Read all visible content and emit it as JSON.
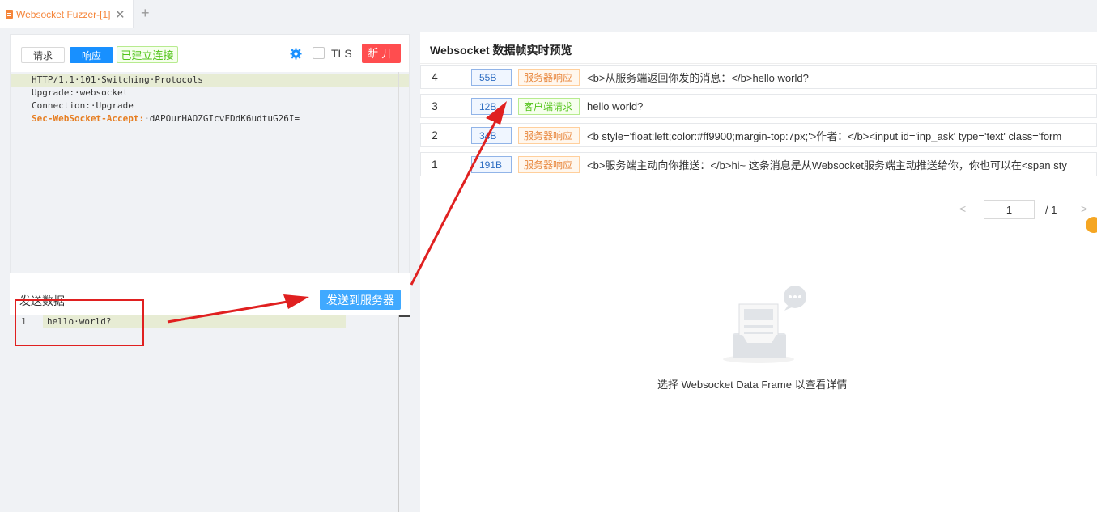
{
  "tab": {
    "title": "Websocket Fuzzer-[1]",
    "close": "✕",
    "add": "+"
  },
  "toolbar": {
    "request_label": "请求",
    "response_label": "响应",
    "status_label": "已建立连接",
    "tls_label": "TLS",
    "disconnect_label": "断开"
  },
  "response_editor": {
    "lines": [
      {
        "text": "HTTP/1.1·101·Switching·Protocols"
      },
      {
        "text": "Upgrade:·websocket"
      },
      {
        "text": "Connection:·Upgrade"
      }
    ],
    "accept_key": "Sec-WebSocket-Accept:",
    "accept_value": "·dAPOurHAOZGIcvFDdK6udtuG26I="
  },
  "send": {
    "title": "发送数据",
    "button_label": "发送到服务器",
    "line_number": "1",
    "code": "hello·world?",
    "dots": "···"
  },
  "preview": {
    "title": "Websocket 数据帧实时预览",
    "rows": [
      {
        "index": "4",
        "size": "55B",
        "type": "服务器响应",
        "kind": "srv",
        "message": "<b>从服务端返回你发的消息：</b>hello world?"
      },
      {
        "index": "3",
        "size": "12B",
        "type": "客户端请求",
        "kind": "cli",
        "message": "hello world?"
      },
      {
        "index": "2",
        "size": "34B",
        "type": "服务器响应",
        "kind": "srv",
        "message": "<b style='float:left;color:#ff9900;margin-top:7px;'>作者：</b><input id='inp_ask' type='text' class='form"
      },
      {
        "index": "1",
        "size": "191B",
        "type": "服务器响应",
        "kind": "srv",
        "message": "<b>服务端主动向你推送：</b>hi~ 这条消息是从Websocket服务端主动推送给你，你也可以在<span sty"
      }
    ],
    "pager": {
      "prev": "<",
      "current": "1",
      "total": "/ 1",
      "next": ">"
    },
    "empty_text": "选择 Websocket Data Frame 以查看详情"
  },
  "colors": {
    "accent": "#1890ff",
    "danger": "#ff4d4f",
    "success": "#52c41a",
    "warning": "#e8873d",
    "annotation": "#e02020"
  }
}
